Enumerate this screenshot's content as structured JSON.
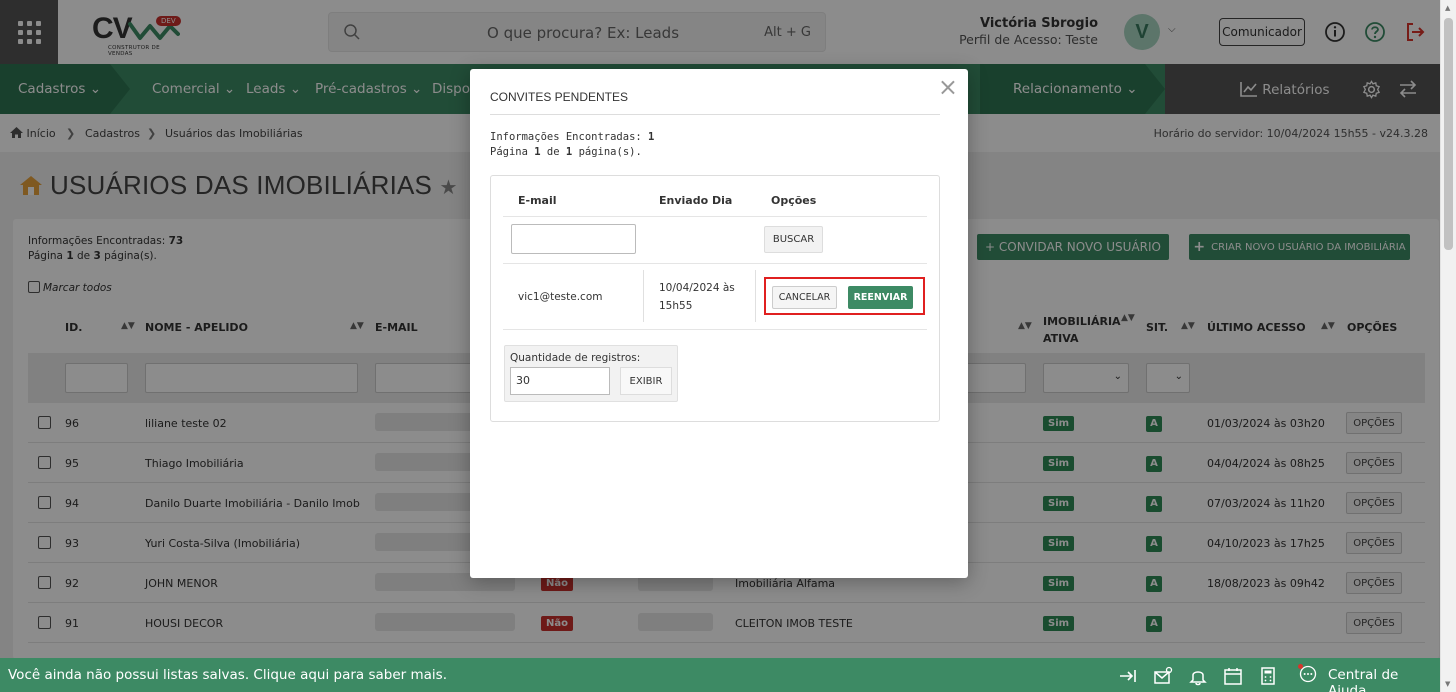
{
  "topbar": {
    "logo_text": "CV",
    "logo_badge": "DEV",
    "logo_subtitle": "CONSTRUTOR DE VENDAS",
    "search_placeholder": "O que procura? Ex: Leads",
    "search_shortcut": "Alt + G",
    "user_name": "Victória Sbrogio",
    "user_profile": "Perfil de Acesso: Teste",
    "avatar_letter": "V",
    "communicator_label": "Comunicador"
  },
  "nav": {
    "items": [
      "Cadastros",
      "Comercial",
      "Leads",
      "Pré-cadastros",
      "Dispo",
      "Relacionamento"
    ],
    "reports_label": "Relatórios"
  },
  "breadcrumb": {
    "items": [
      "Início",
      "Cadastros",
      "Usuários das Imobiliárias"
    ],
    "server_time": "Horário do servidor: 10/04/2024 15h55 - v24.3.28"
  },
  "page": {
    "title": "USUÁRIOS DAS IMOBILIÁRIAS",
    "info_found_label": "Informações Encontradas:",
    "info_found_count": "73",
    "pagination_prefix": "Página",
    "page_current": "1",
    "pagination_mid": "de",
    "page_total": "3",
    "pagination_suffix": "página(s).",
    "select_all_label": "Marcar todos",
    "invite_button": "+ CONVIDAR NOVO USUÁRIO",
    "create_button": "CRIAR NOVO USUÁRIO DA IMOBILIÁRIA"
  },
  "table": {
    "headers": {
      "id": "ID.",
      "name": "NOME - APELIDO",
      "email": "E-MAIL",
      "imob_active_1": "IMOBILIÁRIA",
      "imob_active_2": "ATIVA",
      "sit": "SIT.",
      "last_access": "ÚLTIMO ACESSO",
      "options": "OPÇÕES"
    },
    "rows": [
      {
        "id": "96",
        "name": "liliane teste 02",
        "imob_active": "Sim",
        "sit": "A",
        "last_access": "01/03/2024 às 03h20",
        "options": "OPÇÕES"
      },
      {
        "id": "95",
        "name": "Thiago Imobiliária",
        "imob_active": "Sim",
        "sit": "A",
        "last_access": "04/04/2024 às 08h25",
        "options": "OPÇÕES"
      },
      {
        "id": "94",
        "name": "Danilo Duarte Imobiliária - Danilo Imob",
        "imob_active": "Sim",
        "sit": "A",
        "last_access": "07/03/2024 às 11h20",
        "options": "OPÇÕES"
      },
      {
        "id": "93",
        "name": "Yuri Costa-Silva (Imobiliária)",
        "imob_active": "Sim",
        "sit": "A",
        "last_access": "04/10/2023 às 17h25",
        "options": "OPÇÕES"
      },
      {
        "id": "92",
        "name": "JOHN MENOR",
        "active": "Não",
        "imobiliaria": "Imobiliária Alfama",
        "imob_active": "Sim",
        "sit": "A",
        "last_access": "18/08/2023 às 09h42",
        "options": "OPÇÕES"
      },
      {
        "id": "91",
        "name": "HOUSI DECOR",
        "active": "Não",
        "imobiliaria": "CLEITON IMOB TESTE",
        "imob_active": "Sim",
        "sit": "A",
        "last_access": "",
        "options": "OPÇÕES"
      }
    ]
  },
  "modal": {
    "title": "CONVITES PENDENTES",
    "info_found_label": "Informações Encontradas:",
    "info_found_count": "1",
    "pagination_prefix": "Página",
    "page_current": "1",
    "pagination_mid": "de",
    "page_total": "1",
    "pagination_suffix": "página(s).",
    "headers": {
      "email": "E-mail",
      "sent": "Enviado Dia",
      "options": "Opções"
    },
    "search_button": "BUSCAR",
    "row": {
      "email": "vic1@teste.com",
      "sent_date": "10/04/2024 às",
      "sent_time": "15h55",
      "cancel": "CANCELAR",
      "resend": "REENVIAR"
    },
    "qty_label": "Quantidade de registros:",
    "qty_value": "30",
    "show_button": "EXIBIR"
  },
  "bottombar": {
    "message": "Você ainda não possui listas salvas. Clique aqui para saber mais.",
    "help_label": "Central de Ajuda"
  },
  "colors": {
    "brand_green": "#3d8a64",
    "dark_green": "#2f7553",
    "danger_red": "#c9302c",
    "highlight_red": "#e02020"
  }
}
